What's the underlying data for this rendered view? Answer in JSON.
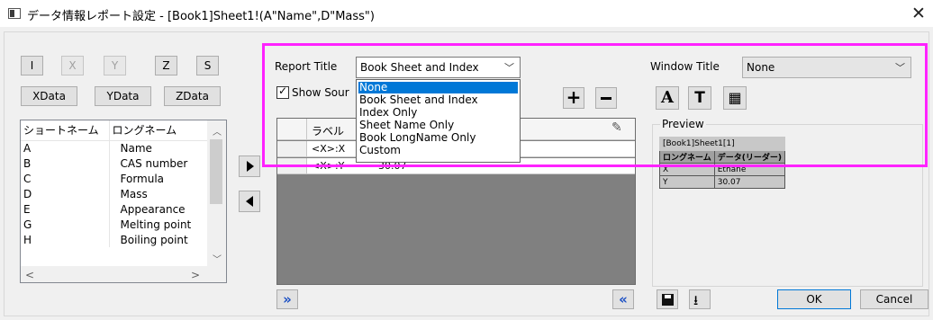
{
  "window": {
    "title": "データ情報レポート設定 - [Book1]Sheet1!(A\"Name\",D\"Mass\")",
    "close_glyph": "✕"
  },
  "axis_buttons": [
    "I",
    "X",
    "Y",
    "Z",
    "S"
  ],
  "data_buttons": [
    "XData",
    "YData",
    "ZData"
  ],
  "column_list": {
    "headers": [
      "ショートネーム",
      "ロングネーム"
    ],
    "rows": [
      [
        "A",
        "Name"
      ],
      [
        "B",
        "CAS number"
      ],
      [
        "C",
        "Formula"
      ],
      [
        "D",
        "Mass"
      ],
      [
        "E",
        "Appearance"
      ],
      [
        "G",
        "Melting point"
      ],
      [
        "H",
        "Boiling point"
      ]
    ]
  },
  "report_title": {
    "label": "Report Title",
    "selected": "Book Sheet and Index",
    "options": [
      "None",
      "Book Sheet and Index",
      "Index Only",
      "Sheet Name Only",
      "Book LongName Only",
      "Custom"
    ],
    "highlighted": "None"
  },
  "show_source": {
    "label": "Show Sour",
    "checked": true
  },
  "grid": {
    "header_label": "ラベル",
    "rows": [
      {
        "tag": "<X>:X",
        "value": ""
      },
      {
        "tag": "<X>:Y",
        "value": "30.07"
      }
    ]
  },
  "window_title": {
    "label": "Window Title",
    "selected": "None"
  },
  "preview": {
    "label": "Preview",
    "title": "[Book1]Sheet1[1]",
    "headers": [
      "ロングネーム",
      "データ(リーダー)"
    ],
    "rows": [
      [
        "X",
        "Ethane"
      ],
      [
        "Y",
        "30.07"
      ]
    ]
  },
  "footer": {
    "ok": "OK",
    "cancel": "Cancel",
    "expand_right": "»",
    "expand_left": "«"
  },
  "accent_color": "#ff22ff",
  "selection_color": "#0078d7"
}
